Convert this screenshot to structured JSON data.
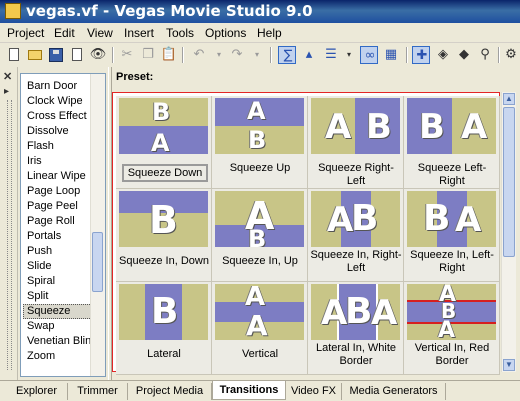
{
  "window": {
    "title": "vegas.vf - Vegas Movie Studio 9.0"
  },
  "menu": [
    "Project",
    "Edit",
    "View",
    "Insert",
    "Tools",
    "Options",
    "Help"
  ],
  "toolbar": {
    "buttons": [
      "new-icon",
      "open-icon",
      "save-icon",
      "properties-icon",
      "cut-icon",
      "copy-icon",
      "paste-icon",
      "delete-icon",
      "undo-icon",
      "redo-icon",
      "snapping-icon",
      "ripple-edit-icon",
      "markers-icon",
      "auto-crossfade-icon",
      "envelope-edit-icon",
      "normal-edit-icon",
      "split-icon",
      "trim-icon",
      "zoom-icon"
    ]
  },
  "transitions_list": {
    "items": [
      "Barn Door",
      "Clock Wipe",
      "Cross Effect",
      "Dissolve",
      "Flash",
      "Iris",
      "Linear Wipe",
      "Page Loop",
      "Page Peel",
      "Page Roll",
      "Portals",
      "Push",
      "Slide",
      "Spiral",
      "Split",
      "Squeeze",
      "Swap",
      "Venetian Blinds",
      "Zoom"
    ],
    "selected": "Squeeze"
  },
  "preset_panel": {
    "label": "Preset:",
    "presets": [
      {
        "name": "Squeeze Down",
        "selected": true
      },
      {
        "name": "Squeeze Up"
      },
      {
        "name": "Squeeze Right-Left"
      },
      {
        "name": "Squeeze Left-Right"
      },
      {
        "name": "Squeeze In, Down"
      },
      {
        "name": "Squeeze In, Up"
      },
      {
        "name": "Squeeze In, Right-Left"
      },
      {
        "name": "Squeeze In, Left-Right"
      },
      {
        "name": "Lateral"
      },
      {
        "name": "Vertical"
      },
      {
        "name": "Lateral In, White Border"
      },
      {
        "name": "Vertical In, Red Border"
      }
    ]
  },
  "thumbnail_letters": {
    "a": "A",
    "b": "B"
  },
  "colors": {
    "thumb_olive": "#c8c587",
    "thumb_blue": "#7d7dc3",
    "red_border": "#d61f1f",
    "selection_outline": "#e32626"
  },
  "tabs": [
    {
      "label": "Explorer"
    },
    {
      "label": "Trimmer"
    },
    {
      "label": "Project Media"
    },
    {
      "label": "Transitions",
      "active": true
    },
    {
      "label": "Video FX"
    },
    {
      "label": "Media Generators"
    }
  ]
}
